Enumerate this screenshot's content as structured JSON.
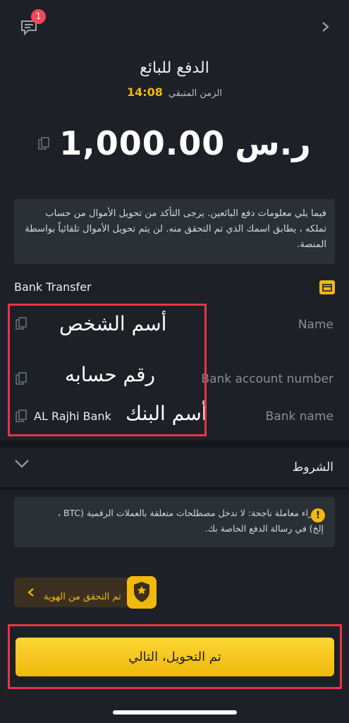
{
  "header": {
    "chat_badge": "1",
    "title": "الدفع للبائع",
    "timer_label": "الزمن المتبقي",
    "timer_value": "14:08"
  },
  "amount": {
    "value": "1,000.00",
    "currency": "ر.س"
  },
  "info_text": "فيما يلي معلومات دفع البائعين. يرجى التأكد من تحويل الأموال من حساب تملكه ، يطابق اسمك الذي تم التحقق منه. لن يتم تحويل الأموال تلقائياً بواسطة المنصة.",
  "payment": {
    "method": "Bank Transfer",
    "rows": [
      {
        "label": "Name",
        "overlay": "أسم الشخص",
        "value": ""
      },
      {
        "label": "Bank account number",
        "overlay": "رقم حسابه",
        "value": ""
      },
      {
        "label": "Bank name",
        "overlay": "أسم البنك",
        "value": "AL Rajhi Bank"
      }
    ]
  },
  "terms": {
    "label": "الشروط"
  },
  "warning_text": "لإجراء معاملة ناجحة: لا تدخل مصطلحات متعلقة بالعملات الرقمية (BTC ، إلخ) في رسالة الدفع الخاصة بك.",
  "verify": {
    "label": "تم التحقق من الهوية"
  },
  "cta": {
    "label": "تم التحويل، التالي"
  },
  "colors": {
    "accent": "#f0b90b",
    "background": "#1e2027",
    "highlight_border": "#e8344a"
  }
}
